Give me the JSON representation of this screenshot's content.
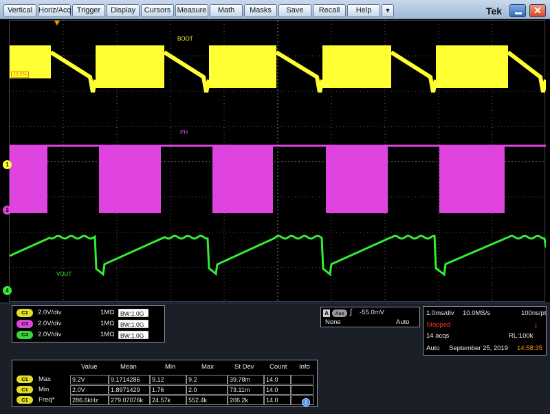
{
  "menu": {
    "items": [
      "Vertical",
      "Horiz/Acq",
      "Trigger",
      "Display",
      "Cursors",
      "Measure",
      "Math",
      "Masks",
      "Save",
      "Recall",
      "Help"
    ],
    "dropdown_icon": "triangle-down-icon",
    "brand": "Tek",
    "minimize_icon": "minimize-icon",
    "close_icon": "close-icon"
  },
  "screen": {
    "labels": {
      "boot": "BOOT",
      "ph": "PH",
      "vout": "VOUT"
    },
    "ref_markers": {
      "ch1": "1",
      "ch3": "3",
      "ch4": "4"
    },
    "ref_level": "10.0%",
    "colors": {
      "ch1": "#ffff33",
      "ch3": "#e044e0",
      "ch4": "#33ee33",
      "grid": "#6e6e6e",
      "trigger": "#ff9900"
    }
  },
  "channels": [
    {
      "id": "C1",
      "scale": "2.0V/div",
      "impedance": "1MΩ",
      "bw": "BW:1.0G",
      "color": "#e4df22"
    },
    {
      "id": "C3",
      "scale": "2.0V/div",
      "impedance": "1MΩ",
      "bw": "BW:1.0G",
      "color": "#d64ad6"
    },
    {
      "id": "C4",
      "scale": "2.0V/div",
      "impedance": "1MΩ",
      "bw": "BW:1.0G",
      "color": "#3ad63a"
    }
  ],
  "trigger": {
    "source_letter": "A",
    "source": "Aux",
    "slope_icon": "rising-edge-icon",
    "level": "-55.0mV",
    "coupling": "None",
    "mode": "Auto"
  },
  "acquisition": {
    "time_div": "1.0ms/div",
    "sample_rate": "10.0MS/s",
    "resolution": "100ns/pt",
    "state": "Stopped",
    "state_icon": "red-down-arrow-icon",
    "acqs": "14 acqs",
    "record_length": "RL:100k",
    "trigger_mode": "Auto",
    "date": "September 25, 2019",
    "time": "14:58:35"
  },
  "measurements": {
    "headers": [
      "Value",
      "Mean",
      "Min",
      "Max",
      "St Dev",
      "Count",
      "Info"
    ],
    "rows": [
      {
        "source": "C1",
        "name": "Max",
        "value": "9.2V",
        "mean": "9.1714286",
        "min": "9.12",
        "max": "9.2",
        "stdev": "39.78m",
        "count": "14.0"
      },
      {
        "source": "C1",
        "name": "Min",
        "value": "2.0V",
        "mean": "1.8971429",
        "min": "1.76",
        "max": "2.0",
        "stdev": "73.11m",
        "count": "14.0"
      },
      {
        "source": "C1",
        "name": "Freq*",
        "value": "286.6kHz",
        "mean": "279.07076k",
        "min": "24.57k",
        "max": "552.4k",
        "stdev": "206.2k",
        "count": "14.0"
      }
    ],
    "info_icon": "info-icon"
  }
}
